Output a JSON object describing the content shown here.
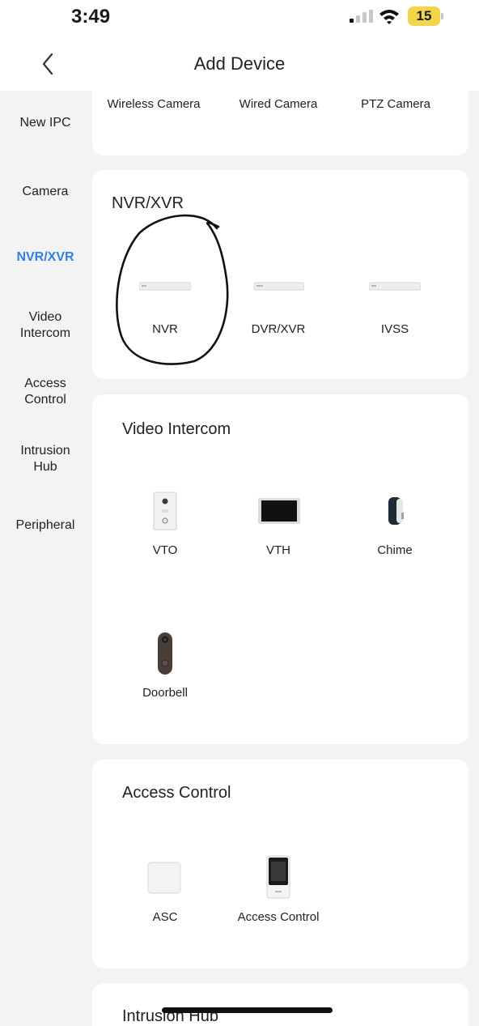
{
  "status_bar": {
    "time": "3:49",
    "battery_level": "15",
    "battery_color": "#f2d54b"
  },
  "nav": {
    "title": "Add Device",
    "back_icon": "chevron-left-icon"
  },
  "sidebar": {
    "active_color": "#2f80ed",
    "items": [
      {
        "label": "New IPC"
      },
      {
        "label": "Camera"
      },
      {
        "label": "NVR/XVR",
        "active": true
      },
      {
        "label": "Video\nIntercom"
      },
      {
        "label": "Access\nControl"
      },
      {
        "label": "Intrusion\nHub"
      },
      {
        "label": "Peripheral"
      }
    ]
  },
  "sections": {
    "new_ipc": {
      "devices": [
        "Wireless Camera",
        "Wired Camera",
        "PTZ Camera"
      ]
    },
    "nvr": {
      "title": "NVR/XVR",
      "devices": [
        "NVR",
        "DVR/XVR",
        "IVSS"
      ]
    },
    "video_intercom": {
      "title": "Video Intercom",
      "devices": [
        "VTO",
        "VTH",
        "Chime",
        "Doorbell"
      ]
    },
    "access_control": {
      "title": "Access Control",
      "devices": [
        "ASC",
        "Access Control"
      ]
    },
    "intrusion_hub": {
      "title": "Intrusion Hub"
    }
  }
}
